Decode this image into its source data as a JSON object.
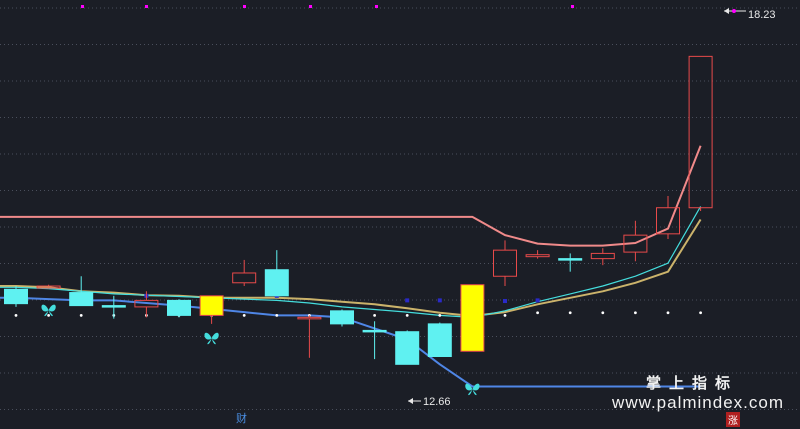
{
  "colors": {
    "background": "#1b1e26",
    "grid": "#4a4f5c",
    "up": "#e84a4a",
    "down": "#5ff1f1",
    "limit_up": "#ffff00",
    "upper_band": "#f08a8a",
    "lower_band": "#4f86e6",
    "ma_cyan": "#44dddd",
    "ma_gold": "#cbb36b",
    "dot_white": "#ffffff",
    "dot_blue": "#2a2ac8",
    "dot_magenta": "#ff00ff",
    "butterfly": "#44dddd"
  },
  "watermark": {
    "cn": "掌上指标",
    "url": "www.palmindex.com"
  },
  "markers": {
    "cai": "财",
    "zhang": "涨"
  },
  "chart_data": {
    "type": "candlestick",
    "ylim": [
      12.3,
      18.4
    ],
    "max_annotation": "18.23",
    "min_annotation": "12.66",
    "candles": [
      {
        "o": 14.15,
        "h": 14.2,
        "l": 13.88,
        "c": 13.93,
        "style": "down"
      },
      {
        "o": 14.2,
        "h": 14.22,
        "l": 14.16,
        "c": 14.17,
        "style": "up"
      },
      {
        "o": 14.1,
        "h": 14.35,
        "l": 13.9,
        "c": 13.9,
        "style": "down"
      },
      {
        "o": 13.9,
        "h": 14.05,
        "l": 13.7,
        "c": 13.88,
        "style": "down"
      },
      {
        "o": 13.88,
        "h": 14.12,
        "l": 13.72,
        "c": 13.98,
        "style": "up"
      },
      {
        "o": 13.98,
        "h": 14.0,
        "l": 13.72,
        "c": 13.75,
        "style": "down"
      },
      {
        "o": 13.75,
        "h": 14.05,
        "l": 13.62,
        "c": 14.05,
        "style": "limit"
      },
      {
        "o": 14.25,
        "h": 14.6,
        "l": 14.2,
        "c": 14.4,
        "style": "up"
      },
      {
        "o": 14.45,
        "h": 14.75,
        "l": 14.05,
        "c": 14.05,
        "style": "down"
      },
      {
        "o": 13.7,
        "h": 13.75,
        "l": 13.1,
        "c": 13.72,
        "style": "doji"
      },
      {
        "o": 13.82,
        "h": 13.84,
        "l": 13.58,
        "c": 13.62,
        "style": "down"
      },
      {
        "o": 13.52,
        "h": 13.66,
        "l": 13.08,
        "c": 13.5,
        "style": "doji-down"
      },
      {
        "o": 13.5,
        "h": 13.52,
        "l": 13.0,
        "c": 13.0,
        "style": "down"
      },
      {
        "o": 13.62,
        "h": 13.64,
        "l": 13.12,
        "c": 13.12,
        "style": "down"
      },
      {
        "o": 13.2,
        "h": 14.22,
        "l": 13.2,
        "c": 14.22,
        "style": "limit"
      },
      {
        "o": 14.35,
        "h": 14.9,
        "l": 14.2,
        "c": 14.75,
        "style": "up"
      },
      {
        "o": 14.68,
        "h": 14.75,
        "l": 14.62,
        "c": 14.65,
        "style": "doji"
      },
      {
        "o": 14.62,
        "h": 14.7,
        "l": 14.42,
        "c": 14.62,
        "style": "doji-down"
      },
      {
        "o": 14.62,
        "h": 14.78,
        "l": 14.52,
        "c": 14.7,
        "style": "up"
      },
      {
        "o": 14.72,
        "h": 15.2,
        "l": 14.58,
        "c": 14.98,
        "style": "up"
      },
      {
        "o": 15.0,
        "h": 15.58,
        "l": 14.92,
        "c": 15.4,
        "style": "up"
      },
      {
        "o": 15.4,
        "h": 17.72,
        "l": 15.35,
        "c": 17.72,
        "style": "up"
      }
    ],
    "upper_band": [
      15.26,
      15.26,
      15.26,
      15.26,
      15.26,
      15.26,
      15.26,
      15.26,
      15.26,
      15.26,
      15.26,
      15.26,
      15.26,
      15.26,
      15.26,
      14.98,
      14.85,
      14.82,
      14.82,
      14.86,
      15.08,
      16.35
    ],
    "lower_band": [
      14.02,
      14.0,
      13.98,
      13.98,
      13.94,
      13.9,
      13.85,
      13.8,
      13.75,
      13.75,
      13.72,
      13.55,
      13.38,
      13.0,
      12.66,
      12.66,
      12.66,
      12.66,
      12.66,
      12.66,
      12.66,
      12.66
    ],
    "ma_fast": [
      14.18,
      14.16,
      14.12,
      14.08,
      14.06,
      14.04,
      14.02,
      14.0,
      13.98,
      13.94,
      13.88,
      13.84,
      13.8,
      13.75,
      13.72,
      13.82,
      13.96,
      14.08,
      14.2,
      14.35,
      14.55,
      15.42
    ],
    "ma_slow": [
      14.2,
      14.18,
      14.12,
      14.1,
      14.06,
      14.05,
      14.02,
      14.02,
      14.02,
      14.0,
      13.96,
      13.92,
      13.86,
      13.79,
      13.74,
      13.8,
      13.92,
      14.02,
      14.12,
      14.25,
      14.42,
      15.22
    ],
    "white_dots": [
      13.75,
      13.75,
      13.75,
      13.75,
      13.75,
      13.75,
      13.75,
      13.75,
      13.75,
      13.75,
      13.75,
      13.75,
      13.75,
      13.75,
      13.75,
      13.75,
      13.79,
      13.79,
      13.79,
      13.79,
      13.79,
      13.79
    ],
    "blue_dots": [
      null,
      null,
      null,
      null,
      14.05,
      null,
      null,
      null,
      14.05,
      null,
      null,
      null,
      13.98,
      13.98,
      null,
      13.97,
      13.98,
      null,
      null,
      null,
      null,
      null
    ],
    "butterflies": [
      {
        "index": 1,
        "value": 13.83
      },
      {
        "index": 6,
        "value": 13.4
      },
      {
        "index": 14,
        "value": 12.62
      }
    ]
  }
}
